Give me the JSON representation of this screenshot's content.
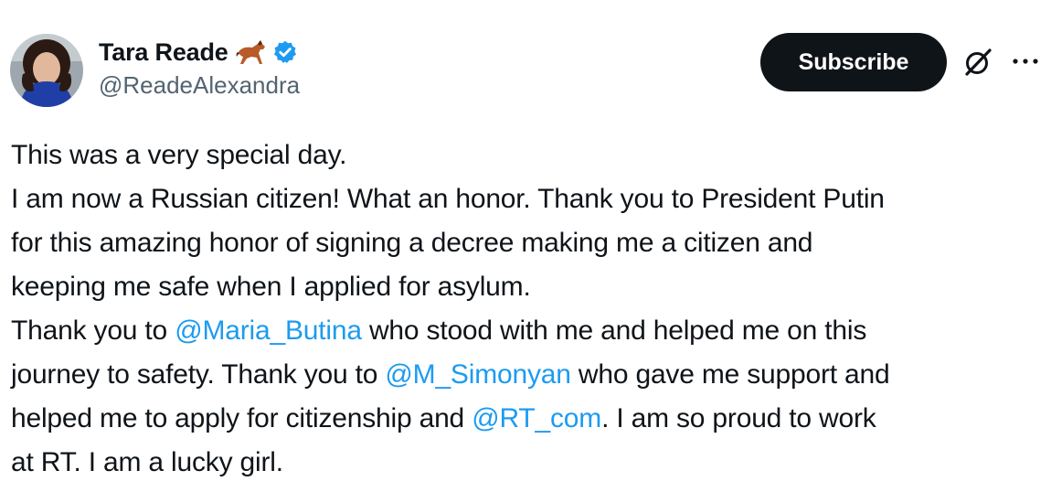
{
  "author": {
    "display_name": "Tara Reade",
    "handle": "@ReadeAlexandra",
    "emoji_icon": "horse-emoji-icon",
    "verified_icon": "verified-badge-icon",
    "verified_color": "#1d9bf0"
  },
  "actions": {
    "subscribe_label": "Subscribe",
    "grok_icon": "grok-icon",
    "more_icon": "more-dots-icon"
  },
  "tweet": {
    "l1": "This was a very special day.",
    "l2": "I am now a Russian citizen! What an honor. Thank you to President Putin",
    "l3": "for this amazing honor of signing a decree making me a citizen and",
    "l4": "keeping me safe when I applied for asylum.",
    "l5a": "Thank you to ",
    "m1": "@Maria_Butina",
    "l5b": " who stood with me and helped me on this",
    "l6a": "journey to safety. Thank you to ",
    "m2": "@M_Simonyan",
    "l6b": " who gave me support and",
    "l7a": "helped me to apply for citizenship and ",
    "m3": "@RT_com",
    "l7b": ". I am so proud to work",
    "l8": "at RT. I am a lucky girl."
  },
  "colors": {
    "text": "#0f1419",
    "secondary": "#536471",
    "link": "#1d9bf0",
    "button_bg": "#0f1419"
  }
}
